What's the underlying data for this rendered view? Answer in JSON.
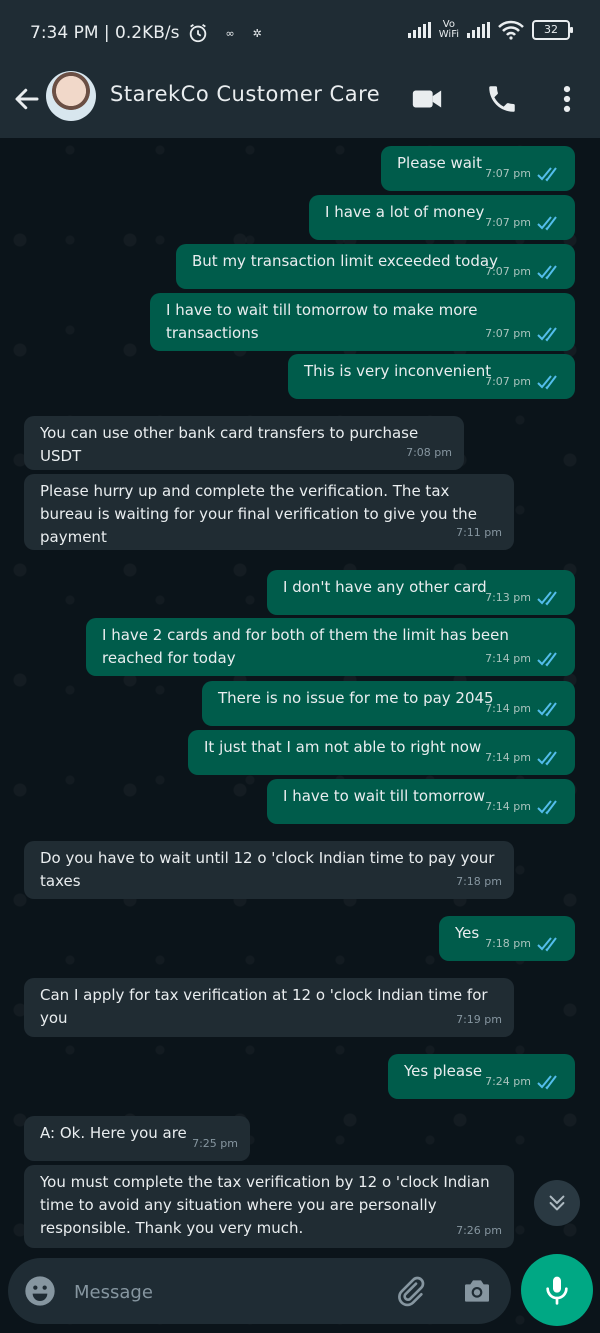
{
  "status_bar": {
    "time_info": "7:34 PM | 0.2KB/s",
    "vo_wifi_top": "Vo",
    "vo_wifi_bottom": "WiFi",
    "battery": "32"
  },
  "header": {
    "contact_name": "StarekCo Customer Care"
  },
  "messages": [
    {
      "dir": "out",
      "text": "Please wait",
      "time": "7:07 pm"
    },
    {
      "dir": "out",
      "text": "I have a lot of money",
      "time": "7:07 pm"
    },
    {
      "dir": "out",
      "text": "But my transaction limit exceeded today",
      "time": "7:07 pm"
    },
    {
      "dir": "out",
      "text": "I have to wait till tomorrow to make more transactions",
      "time": "7:07 pm"
    },
    {
      "dir": "out",
      "text": "This is very inconvenient",
      "time": "7:07 pm"
    },
    {
      "dir": "in",
      "text": "You can use other bank card transfers to purchase USDT",
      "time": "7:08 pm"
    },
    {
      "dir": "in",
      "text": "Please hurry up and complete the verification. The tax bureau is waiting for your final verification to give you the payment",
      "time": "7:11 pm"
    },
    {
      "dir": "out",
      "text": "I don't have any other card",
      "time": "7:13 pm"
    },
    {
      "dir": "out",
      "text": "I have 2 cards and for both of them the limit has been reached for today",
      "time": "7:14 pm"
    },
    {
      "dir": "out",
      "text": "There is no issue for me to pay 2045",
      "time": "7:14 pm"
    },
    {
      "dir": "out",
      "text": "It just that I am not able to right now",
      "time": "7:14 pm"
    },
    {
      "dir": "out",
      "text": "I have to wait till tomorrow",
      "time": "7:14 pm"
    },
    {
      "dir": "in",
      "text": "Do you have to wait until 12 o 'clock Indian time to pay your taxes",
      "time": "7:18 pm"
    },
    {
      "dir": "out",
      "text": "Yes",
      "time": "7:18 pm"
    },
    {
      "dir": "in",
      "text": "Can I apply for tax verification at 12 o 'clock Indian time for you",
      "time": "7:19 pm"
    },
    {
      "dir": "out",
      "text": "Yes please",
      "time": "7:24 pm"
    },
    {
      "dir": "in",
      "text": "A: Ok. Here you are",
      "time": "7:25 pm"
    },
    {
      "dir": "in",
      "text": "You must complete the tax verification by 12 o 'clock Indian time to avoid any situation where you are personally responsible. Thank you very much.",
      "time": "7:26 pm"
    }
  ],
  "composer": {
    "placeholder": "Message"
  },
  "icons": {
    "back": "arrow-left-icon",
    "video": "video-camera-icon",
    "call": "phone-icon",
    "menu": "more-vertical-icon",
    "emoji": "emoji-icon",
    "attach": "paperclip-icon",
    "camera": "camera-icon",
    "mic": "microphone-icon",
    "scroll_down": "double-chevron-down-icon",
    "read_receipt": "double-check-icon"
  },
  "colors": {
    "background": "#0b141a",
    "header": "#1f2c34",
    "outgoing_bubble": "#005c4b",
    "incoming_bubble": "#202c33",
    "accent": "#00a884",
    "read_tick": "#53bdeb"
  }
}
